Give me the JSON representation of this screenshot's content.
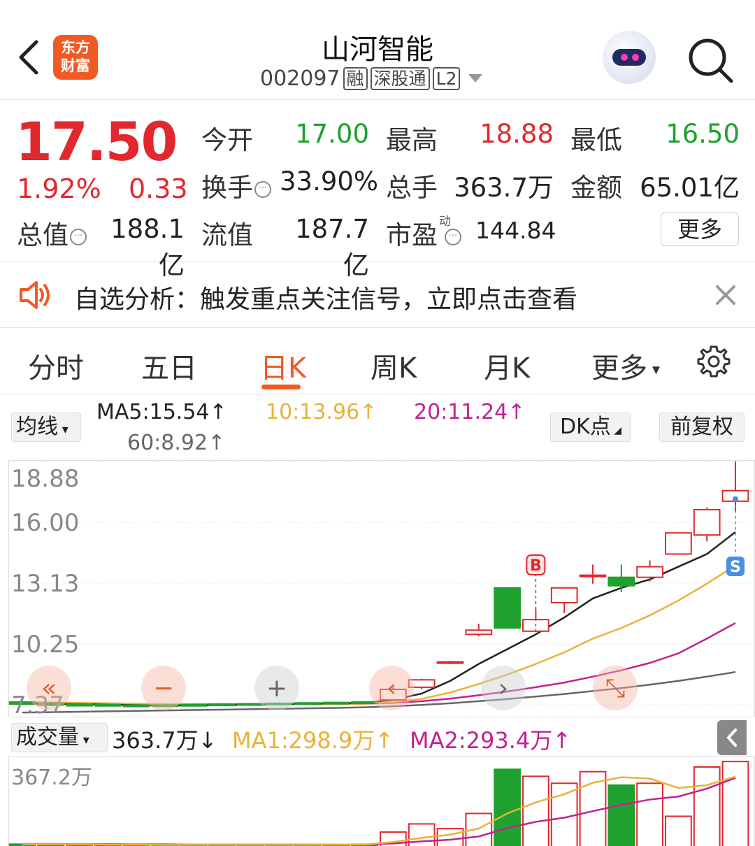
{
  "header": {
    "logo_line1": "东方",
    "logo_line2": "财富",
    "title": "山河智能",
    "code": "002097",
    "tags": [
      "融",
      "深股通",
      "L2"
    ]
  },
  "quote": {
    "price": "17.50",
    "change_pct": "1.92%",
    "change": "0.33",
    "open_label": "今开",
    "open": "17.00",
    "high_label": "最高",
    "high": "18.88",
    "low_label": "最低",
    "low": "16.50",
    "turnover_label": "换手",
    "turnover": "33.90%",
    "volume_label": "总手",
    "volume": "363.7万",
    "amount_label": "金额",
    "amount": "65.01亿",
    "mktcap_label": "总值",
    "mktcap": "188.1亿",
    "float_label": "流值",
    "float": "187.7亿",
    "pe_label": "市盈",
    "pe_sup": "动",
    "pe": "144.84",
    "more": "更多"
  },
  "notice": {
    "text": "自选分析：触发重点关注信号，立即点击查看"
  },
  "tabs": [
    "分时",
    "五日",
    "日K",
    "周K",
    "月K",
    "更多"
  ],
  "ma": {
    "selector": "均线",
    "ma5": "MA5:15.54↑",
    "ma10": "10:13.96↑",
    "ma20": "20:11.24↑",
    "ma60": "60:8.92↑",
    "dk": "DK点",
    "adjust": "前复权"
  },
  "colors": {
    "up": "#e0282e",
    "down": "#1ea12e",
    "accent": "#f15a22",
    "ma5": "#222222",
    "ma10": "#e8b23a",
    "ma20": "#c4218f",
    "ma60": "#666666"
  },
  "chart_data": {
    "type": "candlestick",
    "y_ticks": [
      "18.88",
      "16.00",
      "13.13",
      "10.25",
      "7.37"
    ],
    "ylim": [
      7.37,
      18.88
    ],
    "markers": [
      "B",
      "S"
    ],
    "candles": [
      {
        "o": 7.5,
        "c": 7.4,
        "h": 7.55,
        "l": 7.35
      },
      {
        "o": 7.45,
        "c": 7.35,
        "h": 7.5,
        "l": 7.3
      },
      {
        "o": 7.4,
        "c": 7.32,
        "h": 7.45,
        "l": 7.3
      },
      {
        "o": 7.38,
        "c": 7.33,
        "h": 7.42,
        "l": 7.3
      },
      {
        "o": 7.35,
        "c": 7.3,
        "h": 7.4,
        "l": 7.28
      },
      {
        "o": 7.36,
        "c": 7.34,
        "h": 7.4,
        "l": 7.3
      },
      {
        "o": 7.38,
        "c": 7.36,
        "h": 7.42,
        "l": 7.34
      },
      {
        "o": 7.4,
        "c": 7.38,
        "h": 7.44,
        "l": 7.36
      },
      {
        "o": 7.42,
        "c": 7.4,
        "h": 7.46,
        "l": 7.38
      },
      {
        "o": 7.44,
        "c": 7.42,
        "h": 7.48,
        "l": 7.4
      },
      {
        "o": 7.46,
        "c": 7.44,
        "h": 7.5,
        "l": 7.42
      },
      {
        "o": 7.48,
        "c": 7.46,
        "h": 7.52,
        "l": 7.44
      },
      {
        "o": 7.5,
        "c": 7.48,
        "h": 7.54,
        "l": 7.46
      },
      {
        "o": 7.6,
        "c": 8.1,
        "h": 8.2,
        "l": 7.55
      },
      {
        "o": 8.2,
        "c": 8.55,
        "h": 8.6,
        "l": 8.1
      },
      {
        "o": 9.4,
        "c": 9.4,
        "h": 9.45,
        "l": 9.35
      },
      {
        "o": 10.7,
        "c": 10.9,
        "h": 11.2,
        "l": 10.6
      },
      {
        "o": 12.9,
        "c": 11.0,
        "h": 12.9,
        "l": 11.0
      },
      {
        "o": 10.85,
        "c": 11.4,
        "h": 11.9,
        "l": 10.8
      },
      {
        "o": 12.2,
        "c": 12.9,
        "h": 12.9,
        "l": 11.7
      },
      {
        "o": 13.5,
        "c": 13.5,
        "h": 14.0,
        "l": 13.1
      },
      {
        "o": 13.4,
        "c": 13.0,
        "h": 14.0,
        "l": 12.7
      },
      {
        "o": 13.4,
        "c": 13.9,
        "h": 14.2,
        "l": 13.2
      },
      {
        "o": 14.5,
        "c": 15.5,
        "h": 15.5,
        "l": 14.5
      },
      {
        "o": 15.4,
        "c": 16.6,
        "h": 16.7,
        "l": 15.1
      },
      {
        "o": 17.0,
        "c": 17.5,
        "h": 18.88,
        "l": 16.5
      }
    ],
    "ma5": [
      7.45,
      7.42,
      7.4,
      7.38,
      7.35,
      7.34,
      7.34,
      7.36,
      7.38,
      7.4,
      7.42,
      7.44,
      7.46,
      7.6,
      7.9,
      8.5,
      9.3,
      10.0,
      10.7,
      11.5,
      12.4,
      12.9,
      13.3,
      13.9,
      14.5,
      15.54
    ],
    "ma10": [
      7.5,
      7.48,
      7.46,
      7.44,
      7.42,
      7.4,
      7.39,
      7.38,
      7.38,
      7.39,
      7.4,
      7.41,
      7.42,
      7.5,
      7.65,
      7.95,
      8.35,
      8.8,
      9.3,
      9.85,
      10.5,
      11.0,
      11.6,
      12.3,
      13.1,
      13.96
    ],
    "ma20": [
      7.42,
      7.42,
      7.42,
      7.41,
      7.41,
      7.4,
      7.4,
      7.4,
      7.4,
      7.4,
      7.4,
      7.41,
      7.42,
      7.46,
      7.54,
      7.66,
      7.82,
      8.0,
      8.2,
      8.42,
      8.7,
      9.0,
      9.35,
      9.8,
      10.5,
      11.24
    ],
    "ma60": [
      7.0,
      7.02,
      7.04,
      7.06,
      7.08,
      7.1,
      7.12,
      7.14,
      7.16,
      7.18,
      7.2,
      7.22,
      7.25,
      7.3,
      7.36,
      7.44,
      7.54,
      7.64,
      7.76,
      7.88,
      8.02,
      8.16,
      8.32,
      8.5,
      8.7,
      8.92
    ],
    "volume": {
      "label": "成交量",
      "value": "363.7万↓",
      "ma1": "MA1:298.9万↑",
      "ma2": "MA2:293.4万↑",
      "y_tick": "367.2万",
      "values": [
        8,
        6,
        5,
        5,
        4,
        4,
        5,
        5,
        5,
        6,
        6,
        6,
        7,
        60,
        95,
        75,
        140,
        330,
        300,
        270,
        320,
        262,
        270,
        128,
        340,
        363.7
      ],
      "ma1_values": [
        8,
        8,
        7,
        6,
        6,
        5,
        5,
        5,
        5,
        5,
        5,
        6,
        6,
        17,
        35,
        49,
        75,
        140,
        188,
        223,
        272,
        296,
        290,
        250,
        262,
        298.9
      ],
      "ma2_values": [
        9,
        9,
        8,
        8,
        7,
        7,
        6,
        6,
        6,
        6,
        6,
        6,
        6,
        11,
        20,
        27,
        41,
        77,
        104,
        122,
        150,
        177,
        200,
        213,
        247,
        293.4
      ]
    }
  }
}
